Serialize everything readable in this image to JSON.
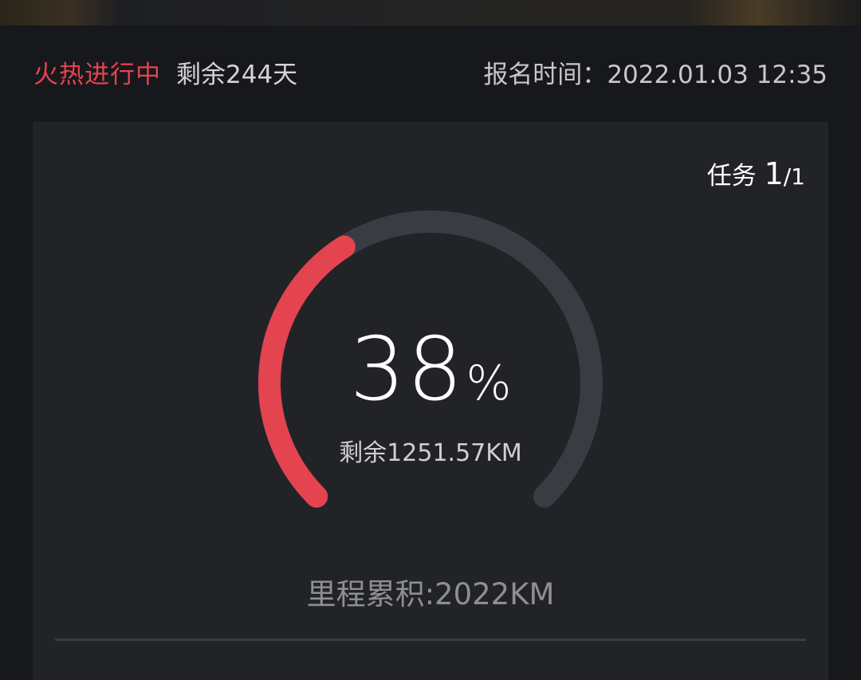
{
  "header": {
    "status": "火热进行中",
    "days_left": "剩余244天",
    "signup_label": "报名时间：",
    "signup_time": "2022.01.03 12:35"
  },
  "card": {
    "task_label": "任务",
    "task_current": "1",
    "task_total": "/1",
    "progress": {
      "value": "38",
      "unit": "%",
      "fraction": 0.38
    },
    "remaining": "剩余1251.57KM",
    "mileage": "里程累积:2022KM"
  },
  "colors": {
    "accent": "#e34450",
    "track": "#3a3c44",
    "card_bg": "#222327",
    "page_bg": "#17181c"
  }
}
